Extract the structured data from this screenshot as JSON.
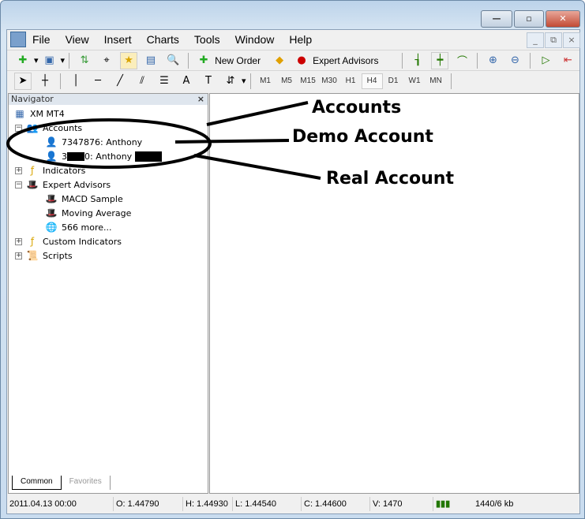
{
  "menu": [
    "File",
    "View",
    "Insert",
    "Charts",
    "Tools",
    "Window",
    "Help"
  ],
  "toolbar": {
    "new_order": "New Order",
    "expert_advisors": "Expert Advisors"
  },
  "timeframes": [
    "M1",
    "M5",
    "M15",
    "M30",
    "H1",
    "H4",
    "D1",
    "W1",
    "MN"
  ],
  "active_timeframe": "H4",
  "navigator": {
    "title": "Navigator",
    "root": "XM MT4",
    "accounts": "Accounts",
    "demo_account": "7347876: Anthony",
    "real_account_prefix": "3",
    "real_account_suffix": "0: Anthony",
    "indicators": "Indicators",
    "expert_advisors": "Expert Advisors",
    "ea_items": [
      "MACD Sample",
      "Moving Average",
      "566 more..."
    ],
    "custom_indicators": "Custom Indicators",
    "scripts": "Scripts",
    "tabs": [
      "Common",
      "Favorites"
    ]
  },
  "status": {
    "datetime": "2011.04.13 00:00",
    "open": "O: 1.44790",
    "high": "H: 1.44930",
    "low": "L: 1.44540",
    "close": "C: 1.44600",
    "volume": "V: 1470",
    "traffic": "1440/6 kb"
  },
  "annotations": {
    "accounts": "Accounts",
    "demo": "Demo Account",
    "real": "Real Account"
  }
}
